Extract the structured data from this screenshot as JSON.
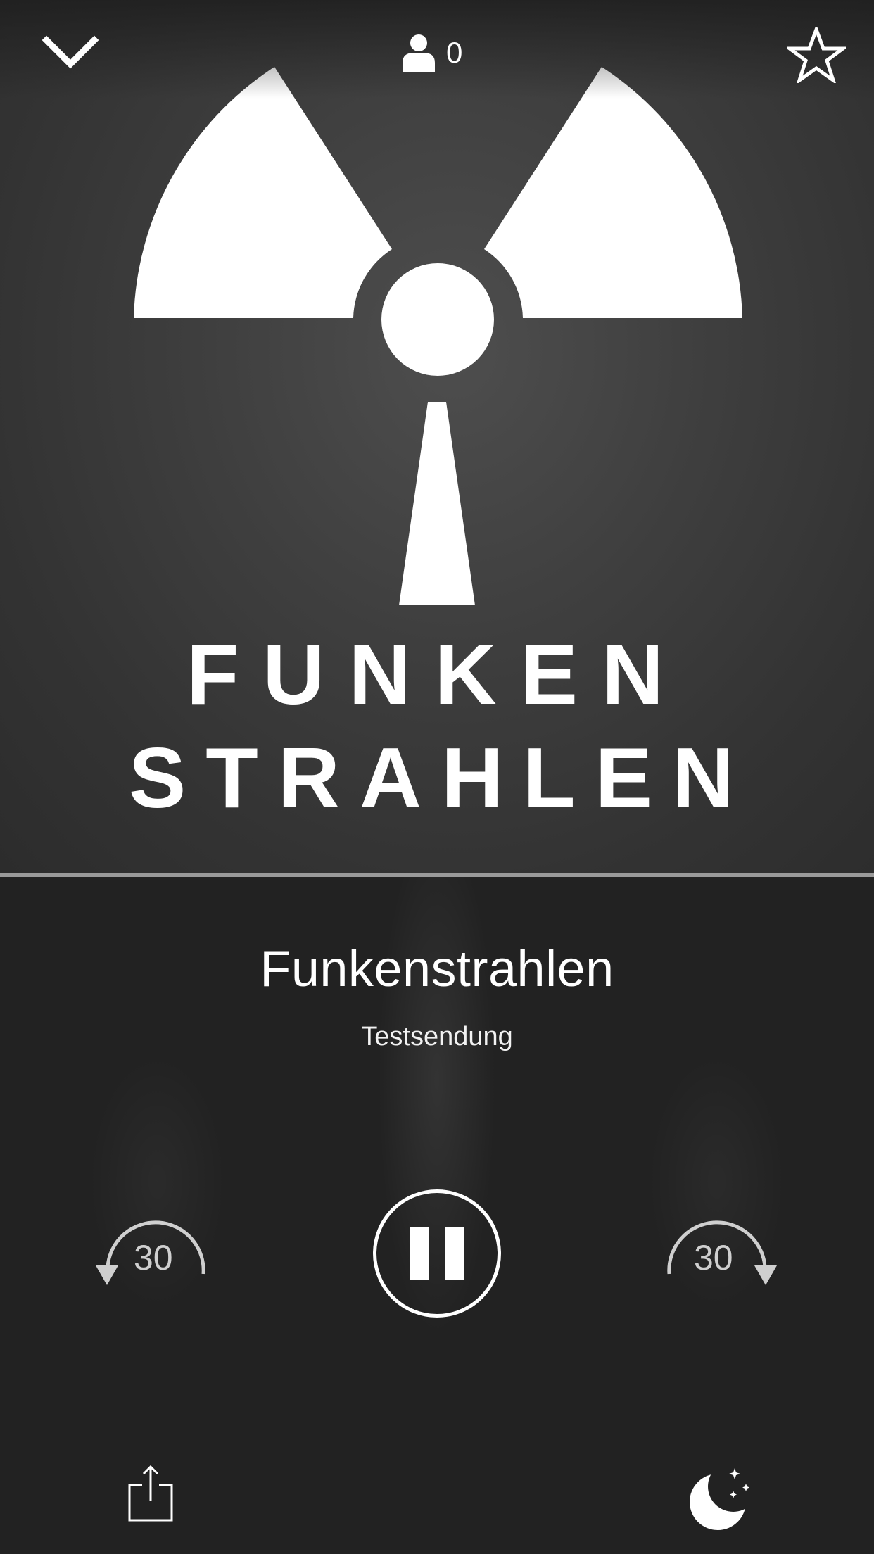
{
  "header": {
    "collapse_icon": "chevron-down-icon",
    "listener_icon": "person-icon",
    "listener_count": "0",
    "favorite_icon": "star-outline-icon"
  },
  "artwork": {
    "logo_icon": "radiation-symbol-icon",
    "line1": "FUNKEN",
    "line2": "STRAHLEN"
  },
  "player": {
    "title": "Funkenstrahlen",
    "subtitle": "Testsendung",
    "skip_back_seconds": "30",
    "skip_forward_seconds": "30",
    "play_state_icon": "pause-icon"
  },
  "footer": {
    "share_icon": "share-icon",
    "sleep_timer_icon": "moon-stars-icon"
  },
  "colors": {
    "artwork_bg": "#3f3f3f",
    "controls_bg": "#222222",
    "foreground": "#ffffff",
    "secondary": "#cfcfcf",
    "progress_track": "#9a9a9a"
  }
}
